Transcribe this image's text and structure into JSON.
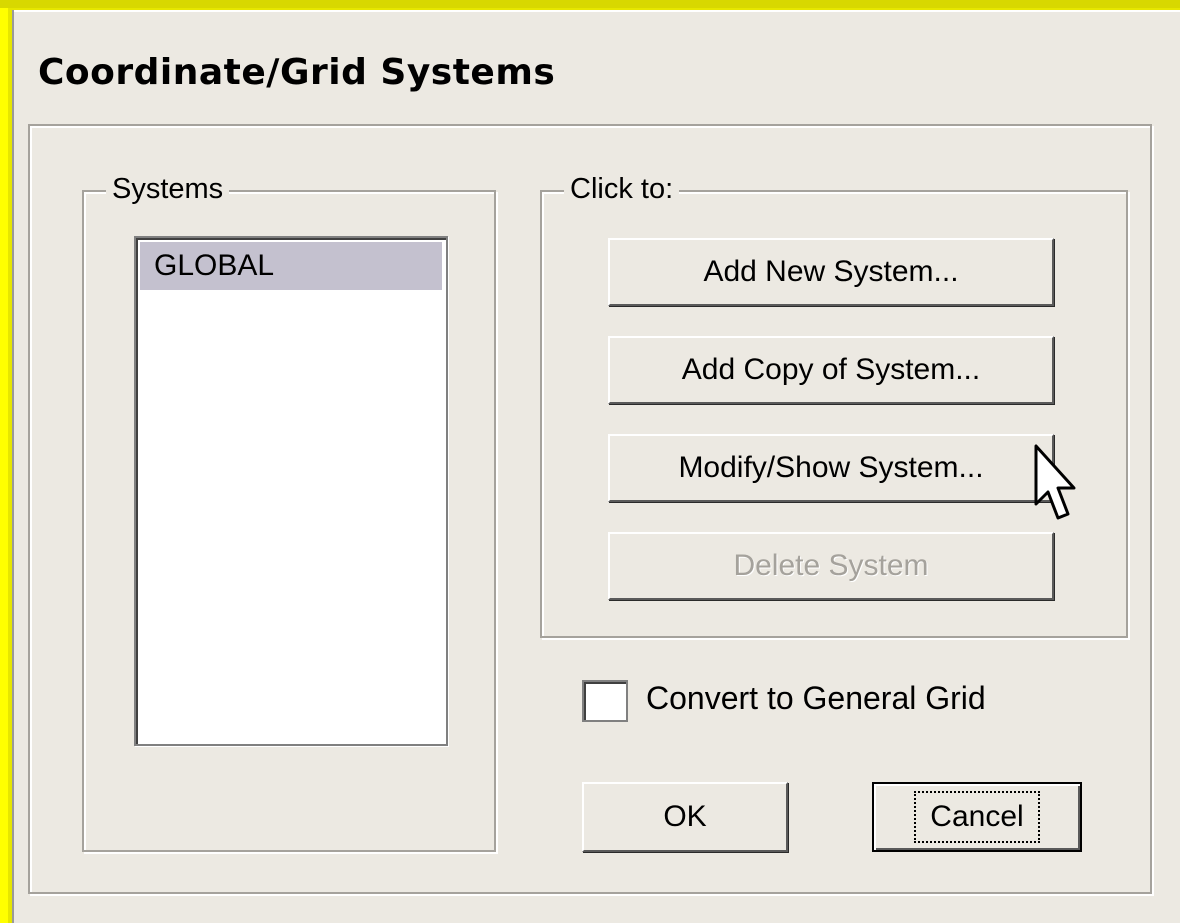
{
  "dialog": {
    "title": "Coordinate/Grid Systems"
  },
  "systems": {
    "legend": "Systems",
    "items": [
      "GLOBAL"
    ],
    "selected": "GLOBAL"
  },
  "actions": {
    "legend": "Click to:",
    "add_new": "Add New System...",
    "add_copy": "Add Copy of System...",
    "modify_show": "Modify/Show System...",
    "delete": "Delete System"
  },
  "options": {
    "convert_label": "Convert to General Grid",
    "convert_checked": false
  },
  "footer": {
    "ok": "OK",
    "cancel": "Cancel"
  },
  "colors": {
    "dialog_bg": "#ece9e2",
    "selection_bg": "#c4c1cf",
    "frame_yellow": "#ffff00"
  }
}
